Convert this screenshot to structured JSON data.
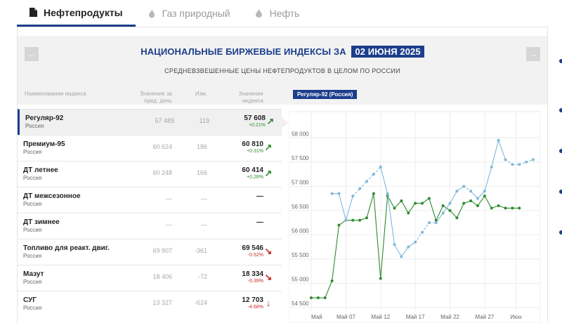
{
  "tabs": [
    {
      "label": "Нефтепродукты",
      "icon": "document-icon",
      "active": true
    },
    {
      "label": "Газ природный",
      "icon": "flame-icon",
      "active": false
    },
    {
      "label": "Нефть",
      "icon": "drop-icon",
      "active": false
    }
  ],
  "header": {
    "title": "НАЦИОНАЛЬНЫЕ БИРЖЕВЫЕ ИНДЕКСЫ ЗА",
    "date": "02 ИЮНЯ 2025",
    "subtitle": "СРЕДНЕВЗВЕШЕННЫЕ ЦЕНЫ НЕФТЕПРОДУКТОВ В ЦЕЛОМ ПО РОССИИ"
  },
  "table": {
    "columns": {
      "name": "Наименование индекса",
      "prev": "Значение за пред. день",
      "change": "Изм.",
      "value": "Значение индекса"
    },
    "rows": [
      {
        "name": "Регуляр-92",
        "region": "Россия",
        "prev": "57 489",
        "change": "119",
        "value": "57 608",
        "pct": "+0.21%",
        "trend": "up",
        "selected": true
      },
      {
        "name": "Премиум-95",
        "region": "Россия",
        "prev": "60 624",
        "change": "186",
        "value": "60 810",
        "pct": "+0.31%",
        "trend": "up",
        "selected": false
      },
      {
        "name": "ДТ летнее",
        "region": "Россия",
        "prev": "60 248",
        "change": "166",
        "value": "60 414",
        "pct": "+0.28%",
        "trend": "up",
        "selected": false
      },
      {
        "name": "ДТ межсезонное",
        "region": "Россия",
        "prev": "—",
        "change": "—",
        "value": "—",
        "pct": "",
        "trend": "none",
        "selected": false
      },
      {
        "name": "ДТ зимнее",
        "region": "Россия",
        "prev": "—",
        "change": "—",
        "value": "—",
        "pct": "",
        "trend": "none",
        "selected": false
      },
      {
        "name": "Топливо для реакт. двиг.",
        "region": "Россия",
        "prev": "69 907",
        "change": "-361",
        "value": "69 546",
        "pct": "-0.52%",
        "trend": "down",
        "selected": false
      },
      {
        "name": "Мазут",
        "region": "Россия",
        "prev": "18 406",
        "change": "-72",
        "value": "18 334",
        "pct": "-0.39%",
        "trend": "down",
        "selected": false
      },
      {
        "name": "СУГ",
        "region": "Россия",
        "prev": "13 327",
        "change": "-624",
        "value": "12 703",
        "pct": "-4.68%",
        "trend": "down-strong",
        "selected": false
      }
    ]
  },
  "chart_tag": "Регуляр-92 (Россия)",
  "chart_data": {
    "type": "line",
    "title": "Регуляр-92 (Россия)",
    "ylim": [
      54500,
      58250
    ],
    "yticks": [
      "58 000",
      "57 500",
      "57 000",
      "56 500",
      "56 000",
      "55 500",
      "55 000",
      "54 500"
    ],
    "ytick_values": [
      58000,
      57500,
      57000,
      56500,
      56000,
      55500,
      55000,
      54500
    ],
    "xlim": [
      0,
      32
    ],
    "xticks": [
      "Май",
      "Май 07",
      "Май 12",
      "Май 17",
      "Май 22",
      "Май 27",
      "Июн"
    ],
    "xtick_positions": [
      0,
      5,
      10,
      15,
      20,
      25,
      29.5
    ],
    "grid": true,
    "series": [
      {
        "color": "#2e8b2e",
        "x": [
          0,
          1,
          2,
          3,
          4,
          5,
          6,
          7,
          8,
          9,
          10,
          11,
          12,
          13,
          14,
          15,
          16,
          17,
          18,
          19,
          20,
          21,
          22,
          23,
          24,
          25,
          26,
          27,
          28,
          29,
          30
        ],
        "y": [
          54700,
          54700,
          54700,
          55050,
          56200,
          56300,
          56300,
          56300,
          56350,
          56850,
          55100,
          56800,
          56550,
          56700,
          56450,
          56650,
          56650,
          56750,
          56300,
          56600,
          56500,
          56350,
          56650,
          56700,
          56600,
          56800,
          56550,
          56600,
          56550,
          56550,
          56550
        ]
      },
      {
        "color": "#7fb8d8",
        "x": [
          3,
          4,
          5,
          6,
          7,
          8,
          9,
          10,
          11,
          12,
          13,
          14,
          15,
          16,
          17,
          18,
          19,
          20,
          21,
          22,
          23,
          24,
          25,
          26,
          27,
          28,
          29,
          30,
          31,
          32
        ],
        "y": [
          56850,
          56850,
          56300,
          56800,
          56950,
          57100,
          57250,
          57400,
          56850,
          55800,
          55550,
          55750,
          55850,
          56050,
          56250,
          56250,
          56450,
          56650,
          56900,
          57000,
          56900,
          56750,
          56900,
          57400,
          57950,
          57550,
          57450,
          57450,
          57500,
          57550
        ],
        "gap_segments": [
          [
            6,
            10
          ],
          [
            15,
            18
          ],
          [
            22,
            23
          ],
          [
            28,
            32
          ]
        ]
      }
    ]
  }
}
